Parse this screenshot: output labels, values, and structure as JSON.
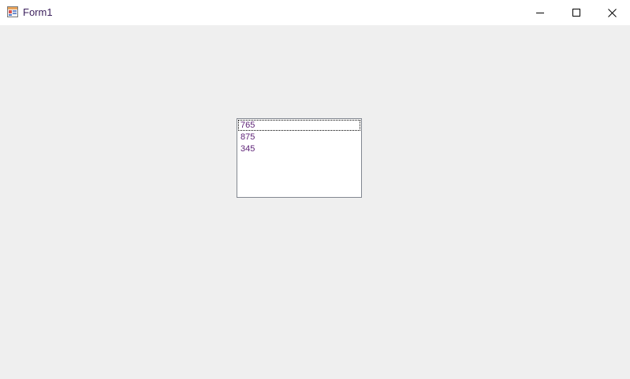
{
  "window": {
    "title": "Form1",
    "icon": "winforms-app-icon",
    "controls": {
      "minimize": "minimize-icon",
      "maximize": "maximize-icon",
      "close": "close-icon"
    }
  },
  "listbox": {
    "items": [
      {
        "label": "765",
        "focused": true
      },
      {
        "label": "875",
        "focused": false
      },
      {
        "label": "345",
        "focused": false
      }
    ],
    "item_color": "#5b1f75"
  },
  "colors": {
    "form_background": "#efefef",
    "titlebar_background": "#ffffff",
    "title_text": "#3b1f5c",
    "listbox_border": "#828790"
  }
}
